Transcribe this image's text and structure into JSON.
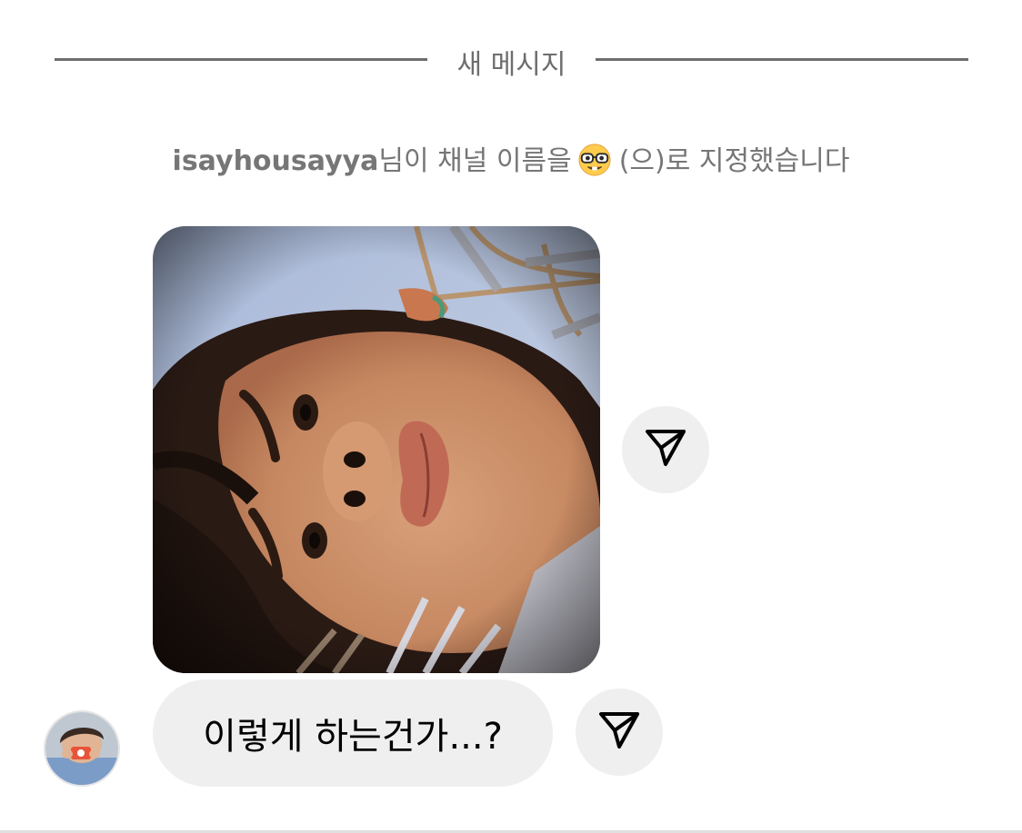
{
  "divider": {
    "label": "새 메시지"
  },
  "system_message": {
    "username": "isayhousayya",
    "text_before_emoji": "님이 채널 이름을",
    "emoji_icon": "nerd-face-icon",
    "text_after_emoji": "(으)로 지정했습니다"
  },
  "thread": {
    "photo_message": {
      "share_icon": "send-icon"
    },
    "text_message": {
      "text": "이렇게 하는건가...?",
      "share_icon": "send-icon"
    },
    "sender_avatar_icon": "user-avatar"
  },
  "colors": {
    "divider": "#6e6e6e",
    "system_text": "#767676",
    "bubble_bg": "#efefef",
    "share_button_bg": "#efefef",
    "text": "#000000",
    "background": "#ffffff"
  }
}
